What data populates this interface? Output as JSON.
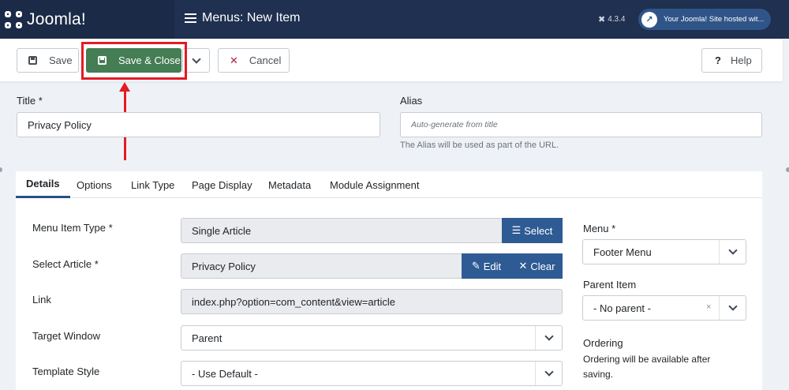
{
  "header": {
    "brand": "Joomla!",
    "title": "Menus: New Item",
    "version": "4.3.4",
    "hosted_link": "Your Joomla! Site hosted wit..."
  },
  "toolbar": {
    "save": "Save",
    "save_close": "Save & Close",
    "cancel": "Cancel",
    "help": "Help"
  },
  "form": {
    "title_label": "Title *",
    "title_value": "Privacy Policy",
    "alias_label": "Alias",
    "alias_placeholder": "Auto-generate from title",
    "alias_hint": "The Alias will be used as part of the URL."
  },
  "tabs": [
    "Details",
    "Options",
    "Link Type",
    "Page Display",
    "Metadata",
    "Module Assignment"
  ],
  "details": {
    "menu_item_type_label": "Menu Item Type *",
    "menu_item_type_value": "Single Article",
    "select_label": "Select",
    "select_article_label": "Select Article *",
    "select_article_value": "Privacy Policy",
    "edit_label": "Edit",
    "clear_label": "Clear",
    "link_label": "Link",
    "link_value": "index.php?option=com_content&view=article",
    "target_window_label": "Target Window",
    "target_window_value": "Parent",
    "template_style_label": "Template Style",
    "template_style_value": "- Use Default -"
  },
  "sidebar": {
    "menu_label": "Menu *",
    "menu_value": "Footer Menu",
    "parent_label": "Parent Item",
    "parent_value": "- No parent -",
    "parent_clear": "×",
    "ordering_label": "Ordering",
    "ordering_text": "Ordering will be available after saving."
  },
  "colors": {
    "header_bg": "#1f3050",
    "save_close_bg": "#457d54",
    "primary_blue": "#2f5b94",
    "annotation_red": "#e31b23"
  }
}
